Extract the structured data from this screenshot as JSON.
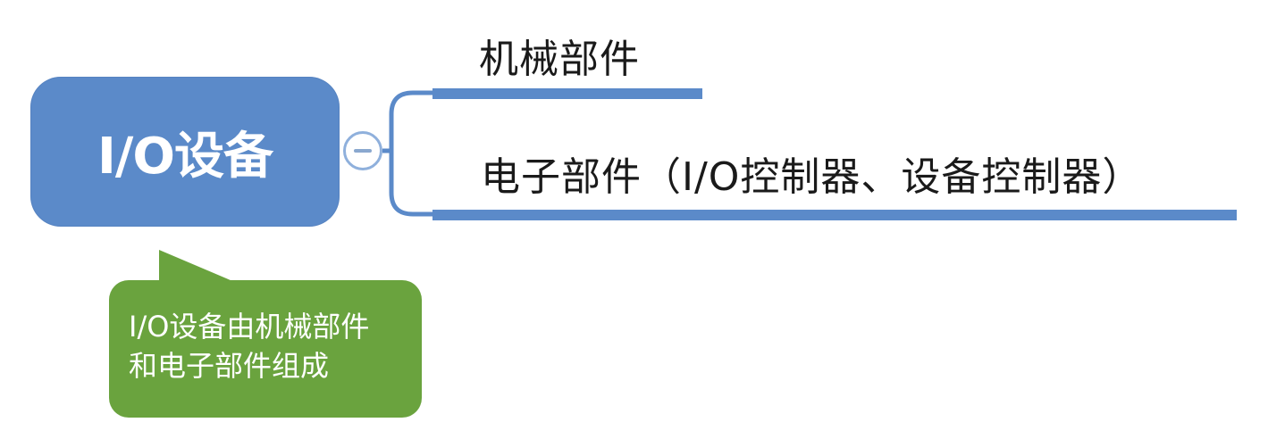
{
  "root": {
    "label": "I/O设备"
  },
  "branches": [
    {
      "label": "机械部件"
    },
    {
      "label": "电子部件（I/O控制器、设备控制器）"
    }
  ],
  "note": {
    "text": "I/O设备由机械部件\n和电子部件组成"
  },
  "colors": {
    "root_fill": "#5b8ac9",
    "branch_line": "#5b8ac9",
    "note_fill": "#6aa33e",
    "toggle_border": "#8fb0dc"
  },
  "icons": {
    "toggle": "minus-icon"
  }
}
